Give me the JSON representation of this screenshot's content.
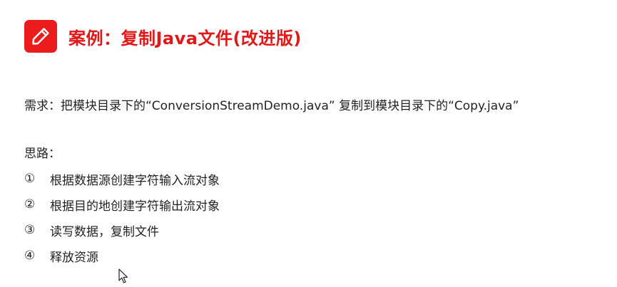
{
  "title": {
    "icon": "pencil-icon",
    "text": "案例：复制Java文件(改进版)",
    "color": "#e0181a",
    "icon_bg": "#ea1c1c"
  },
  "requirement": "需求：把模块目录下的“ConversionStreamDemo.java” 复制到模块目录下的“Copy.java”",
  "ideas": {
    "heading": "思路：",
    "steps": [
      {
        "num": "①",
        "text": "根据数据源创建字符输入流对象"
      },
      {
        "num": "②",
        "text": "根据目的地创建字符输出流对象"
      },
      {
        "num": "③",
        "text": "读写数据，复制文件"
      },
      {
        "num": "④",
        "text": "释放资源"
      }
    ]
  },
  "cursor": "mouse-pointer-icon"
}
